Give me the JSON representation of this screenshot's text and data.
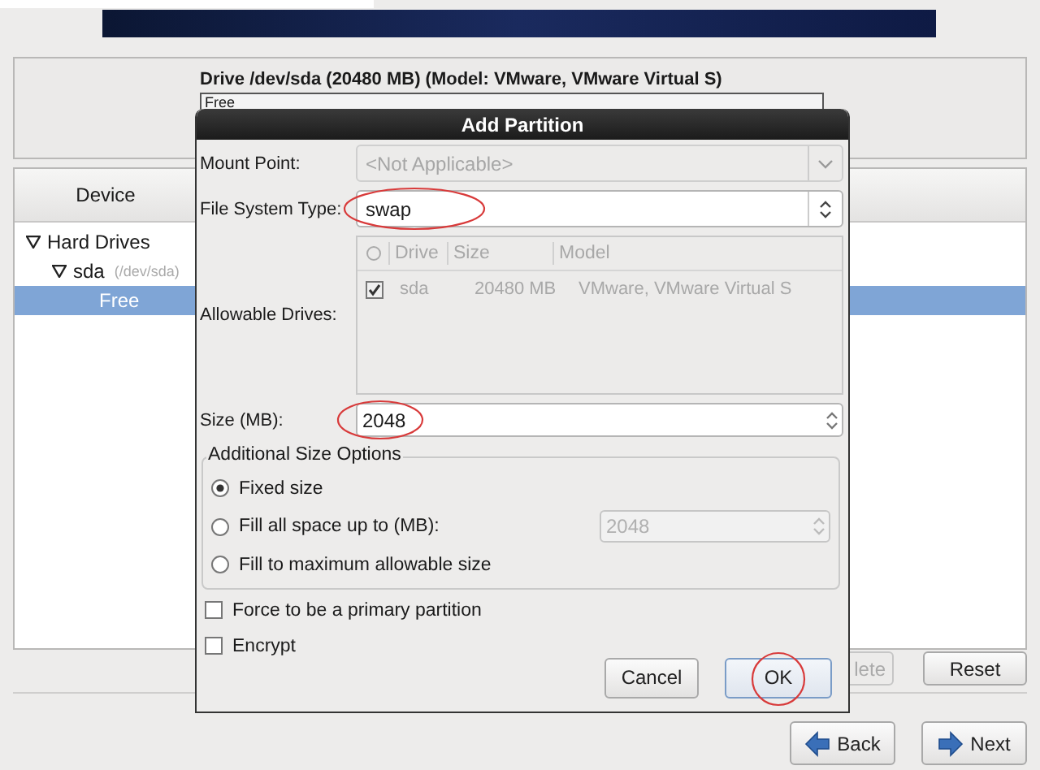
{
  "drive_panel": {
    "title": "Drive /dev/sda (20480 MB) (Model: VMware, VMware Virtual S)",
    "segments": [
      {
        "label": "Free"
      }
    ]
  },
  "device_panel": {
    "columns": [
      "Device"
    ],
    "tree": [
      {
        "label": "Hard Drives",
        "expanded": true,
        "children": [
          {
            "label": "sda",
            "note": "(/dev/sda)",
            "expanded": true,
            "children": [
              {
                "label": "Free",
                "selected": true
              }
            ]
          }
        ]
      }
    ]
  },
  "panel_buttons": [
    {
      "label": "lete",
      "disabled": true
    },
    {
      "label": "Reset",
      "disabled": false
    }
  ],
  "nav_buttons": [
    {
      "label": "Back",
      "kind": "back"
    },
    {
      "label": "Next",
      "kind": "next"
    }
  ],
  "dialog": {
    "title": "Add Partition",
    "mount_point": {
      "label": "Mount Point:",
      "value": "<Not Applicable>",
      "disabled": true
    },
    "fs_type": {
      "label": "File System Type:",
      "value": "swap",
      "circled": true
    },
    "allowable_drives": {
      "label": "Allowable Drives:",
      "columns": [
        "Drive",
        "Size",
        "Model"
      ],
      "rows": [
        {
          "checked": true,
          "drive": "sda",
          "size": "20480 MB",
          "model": "VMware, VMware Virtual S"
        }
      ]
    },
    "size": {
      "label": "Size (MB):",
      "value": "2048",
      "circled": true
    },
    "size_options": {
      "title": "Additional Size Options",
      "options": [
        {
          "label": "Fixed size",
          "selected": true
        },
        {
          "label": "Fill all space up to (MB):",
          "selected": false
        },
        {
          "label": "Fill to maximum allowable size",
          "selected": false
        }
      ],
      "fill_value": "2048"
    },
    "checkboxes": [
      {
        "label": "Force to be a primary partition",
        "checked": false
      },
      {
        "label": "Encrypt",
        "checked": false
      }
    ],
    "buttons": [
      {
        "label": "Cancel",
        "default": false,
        "circled": false
      },
      {
        "label": "OK",
        "default": true,
        "circled": true
      }
    ]
  }
}
